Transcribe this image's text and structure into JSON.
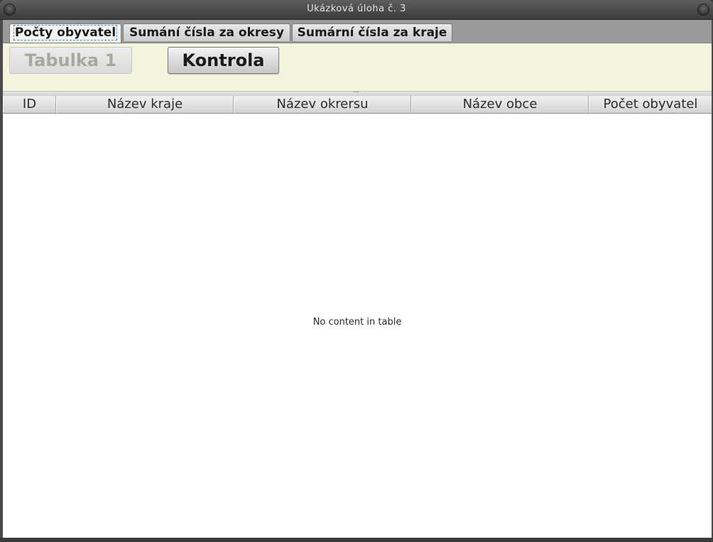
{
  "window": {
    "title": "Ukázková úloha č. 3"
  },
  "tabs": [
    {
      "label": "Počty obyvatel",
      "active": true
    },
    {
      "label": "Sumání čísla za okresy",
      "active": false
    },
    {
      "label": "Sumární čísla za kraje",
      "active": false
    }
  ],
  "toolbar": {
    "tabulka_label": "Tabulka 1",
    "kontrola_label": "Kontrola",
    "splitter_grip": "..."
  },
  "table": {
    "columns": [
      "ID",
      "Název kraje",
      "Název okrersu",
      "Název obce",
      "Počet obyvatel"
    ],
    "empty_message": "No content in table"
  },
  "colors": {
    "toolbar_bg": "#f4f3de",
    "tabbar_bg": "#9a9a9a",
    "titlebar_bg": "#4a4a4a"
  }
}
